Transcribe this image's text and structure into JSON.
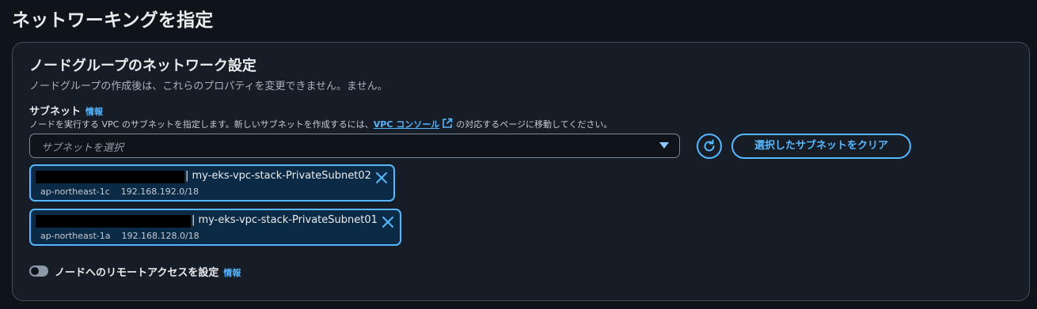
{
  "page": {
    "title": "ネットワーキングを指定"
  },
  "panel": {
    "title": "ノードグループのネットワーク設定",
    "description": "ノードグループの作成後は、これらのプロパティを変更できません。ません。"
  },
  "subnet_field": {
    "label": "サブネット",
    "info_link": "情報",
    "desc_before": "ノードを実行する VPC のサブネットを指定します。新しいサブネットを作成するには、",
    "vpc_console_link": "VPC コンソール",
    "desc_after": "の対応するページに移動してください。",
    "placeholder": "サブネットを選択",
    "refresh_icon": "refresh-icon",
    "clear_button_label": "選択したサブネットをクリア"
  },
  "selected_subnets": [
    {
      "name": "| my-eks-vpc-stack-PrivateSubnet02",
      "az": "ap-northeast-1c",
      "cidr": "192.168.192.0/18"
    },
    {
      "name": "| my-eks-vpc-stack-PrivateSubnet01",
      "az": "ap-northeast-1a",
      "cidr": "192.168.128.0/18"
    }
  ],
  "remote_access": {
    "label": "ノードへのリモートアクセスを設定",
    "info_link": "情報",
    "enabled": false
  },
  "colors": {
    "background": "#0f141a",
    "panel": "#161d26",
    "accent": "#56b7ff",
    "token_bg": "#0b2a45"
  }
}
